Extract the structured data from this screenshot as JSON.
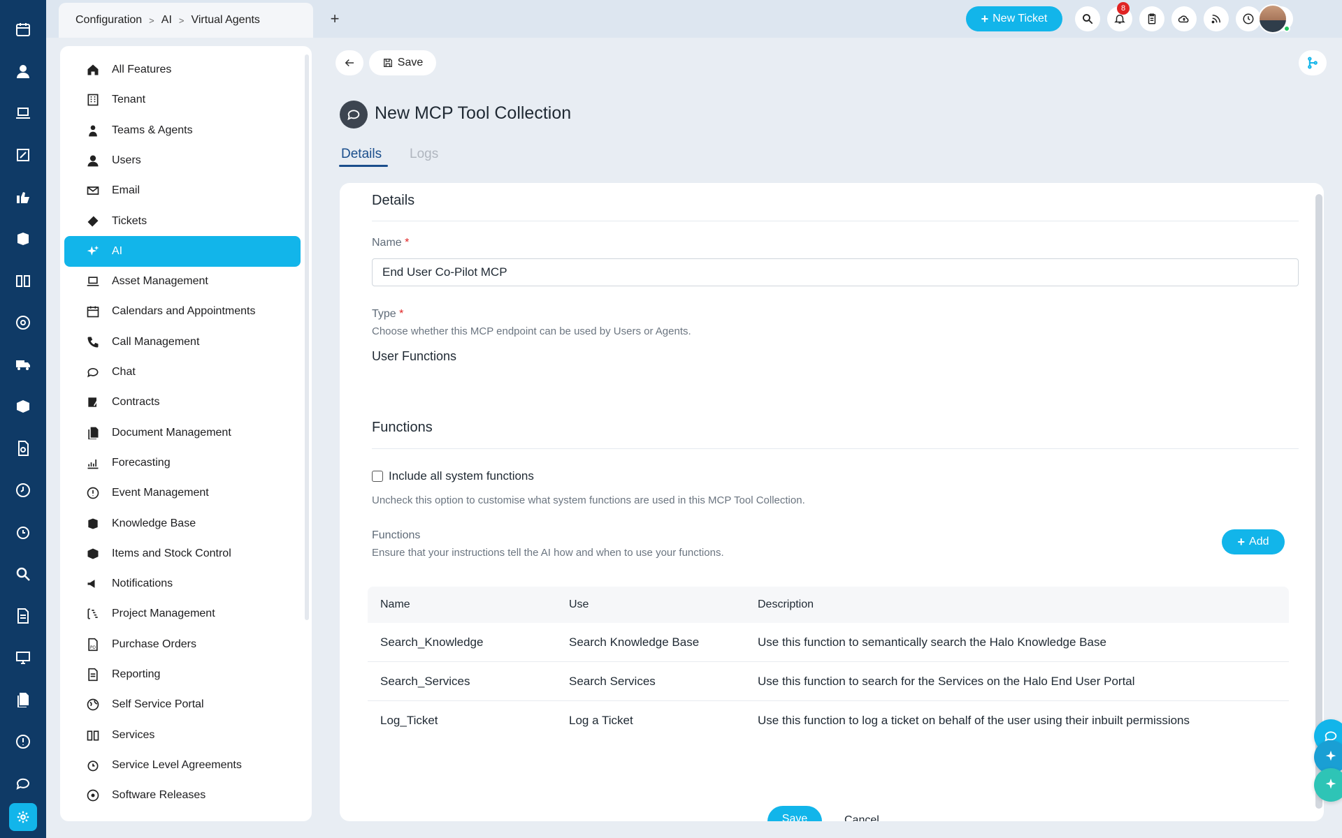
{
  "breadcrumb": [
    "Configuration",
    "AI",
    "Virtual Agents"
  ],
  "topbar": {
    "new_ticket_label": "New Ticket",
    "notification_count": "8",
    "icons": [
      "search-icon",
      "bell-icon",
      "clipboard-icon",
      "cloud-icon",
      "feed-icon",
      "clock-icon",
      "help-icon"
    ]
  },
  "features": [
    {
      "label": "All Features",
      "icon": "home-icon"
    },
    {
      "label": "Tenant",
      "icon": "building-icon"
    },
    {
      "label": "Teams & Agents",
      "icon": "agent-icon"
    },
    {
      "label": "Users",
      "icon": "user-icon"
    },
    {
      "label": "Email",
      "icon": "email-icon"
    },
    {
      "label": "Tickets",
      "icon": "ticket-icon"
    },
    {
      "label": "AI",
      "icon": "sparkle-icon",
      "active": true
    },
    {
      "label": "Asset Management",
      "icon": "laptop-icon"
    },
    {
      "label": "Calendars and Appointments",
      "icon": "calendar-icon"
    },
    {
      "label": "Call Management",
      "icon": "phone-icon"
    },
    {
      "label": "Chat",
      "icon": "chat-icon"
    },
    {
      "label": "Contracts",
      "icon": "contract-icon"
    },
    {
      "label": "Document Management",
      "icon": "document-icon"
    },
    {
      "label": "Forecasting",
      "icon": "chart-icon"
    },
    {
      "label": "Event Management",
      "icon": "alert-icon"
    },
    {
      "label": "Knowledge Base",
      "icon": "knowledge-icon"
    },
    {
      "label": "Items and Stock Control",
      "icon": "box-icon"
    },
    {
      "label": "Notifications",
      "icon": "megaphone-icon"
    },
    {
      "label": "Project Management",
      "icon": "project-icon"
    },
    {
      "label": "Purchase Orders",
      "icon": "po-icon"
    },
    {
      "label": "Reporting",
      "icon": "report-icon"
    },
    {
      "label": "Self Service Portal",
      "icon": "globe-icon"
    },
    {
      "label": "Services",
      "icon": "book-icon"
    },
    {
      "label": "Service Level Agreements",
      "icon": "timer-icon"
    },
    {
      "label": "Software Releases",
      "icon": "disc-icon"
    }
  ],
  "toolbar": {
    "save_label": "Save"
  },
  "page": {
    "title": "New MCP Tool Collection",
    "tabs": [
      "Details",
      "Logs"
    ]
  },
  "details": {
    "section_title": "Details",
    "name_label": "Name",
    "name_value": "End User Co-Pilot MCP",
    "type_label": "Type",
    "type_hint": "Choose whether this MCP endpoint can be used by Users or Agents.",
    "type_value": "User Functions"
  },
  "functions": {
    "section_title": "Functions",
    "include_all_label": "Include all system functions",
    "include_all_checked": false,
    "include_all_hint": "Uncheck this option to customise what system functions are used in this MCP Tool Collection.",
    "list_label": "Functions",
    "list_hint": "Ensure that your instructions tell the AI how and when to use your functions.",
    "add_label": "Add",
    "columns": [
      "Name",
      "Use",
      "Description"
    ],
    "rows": [
      [
        "Search_Knowledge",
        "Search Knowledge Base",
        "Use this function to semantically search the Halo Knowledge Base"
      ],
      [
        "Search_Services",
        "Search Services",
        "Use this function to search for the Services on the Halo End User Portal"
      ],
      [
        "Log_Ticket",
        "Log a Ticket",
        "Use this function to log a ticket on behalf of the user using their inbuilt permissions"
      ]
    ]
  },
  "footer": {
    "save_label": "Save",
    "cancel_label": "Cancel"
  },
  "colors": {
    "accent": "#12b5ea",
    "rail": "#0f3a66",
    "tab_active": "#1a4e8c"
  }
}
